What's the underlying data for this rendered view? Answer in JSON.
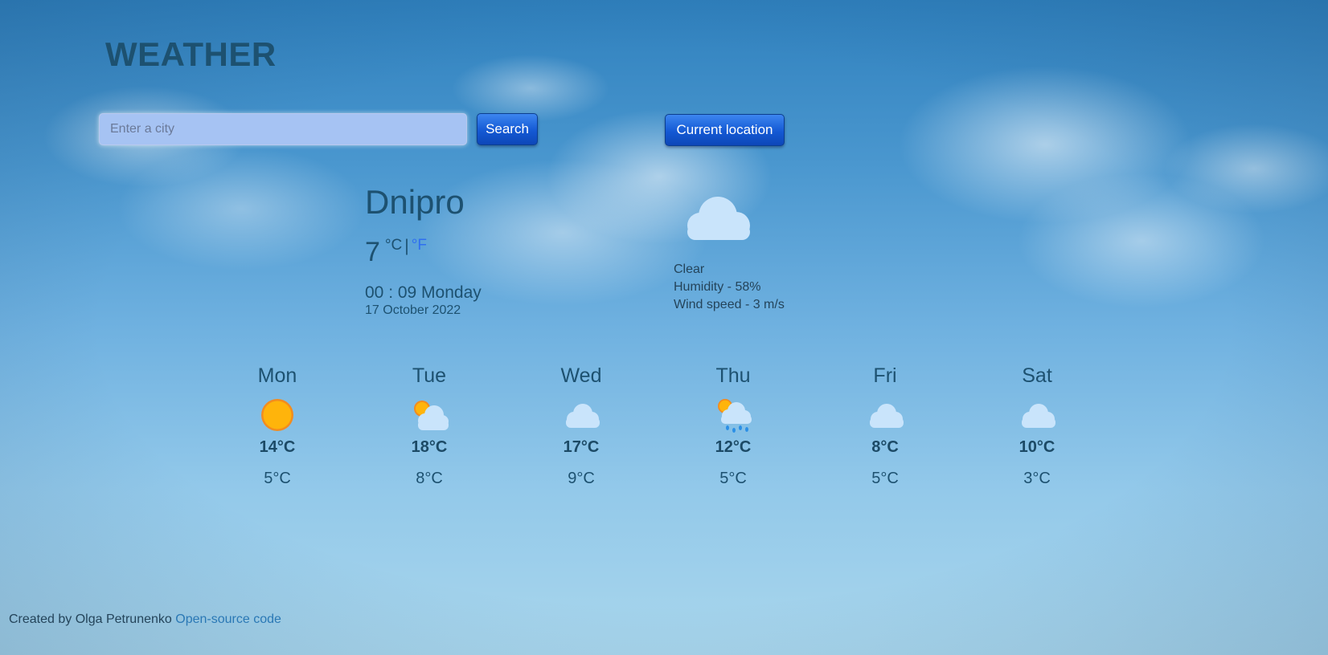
{
  "app": {
    "title": "WEATHER"
  },
  "search": {
    "placeholder": "Enter a city",
    "value": "",
    "button_label": "Search"
  },
  "location_button_label": "Current location",
  "current": {
    "city": "Dnipro",
    "temperature": "7",
    "unit_c": "°C",
    "separator": "|",
    "unit_f": "°F",
    "time": "00 : 09 Monday",
    "date": "17 October 2022",
    "icon": "cloud-icon",
    "description": "Clear",
    "humidity": "Humidity - 58%",
    "wind": "Wind speed - 3 m/s"
  },
  "forecast": [
    {
      "day": "Mon",
      "icon": "sun-icon",
      "max": "14°C",
      "min": "5°C"
    },
    {
      "day": "Tue",
      "icon": "sun-cloud-icon",
      "max": "18°C",
      "min": "8°C"
    },
    {
      "day": "Wed",
      "icon": "cloud-icon",
      "max": "17°C",
      "min": "9°C"
    },
    {
      "day": "Thu",
      "icon": "sun-rain-icon",
      "max": "12°C",
      "min": "5°C"
    },
    {
      "day": "Fri",
      "icon": "cloud-icon",
      "max": "8°C",
      "min": "5°C"
    },
    {
      "day": "Sat",
      "icon": "cloud-icon",
      "max": "10°C",
      "min": "3°C"
    }
  ],
  "footer": {
    "text": "Created by Olga Petrunenko",
    "link_text": "Open-source code"
  },
  "colors": {
    "title": "#1d5170",
    "button": "#1459d4",
    "link": "#2a78b5",
    "unit_link": "#2f6ff0",
    "input_bg": "#a6c3f3"
  }
}
